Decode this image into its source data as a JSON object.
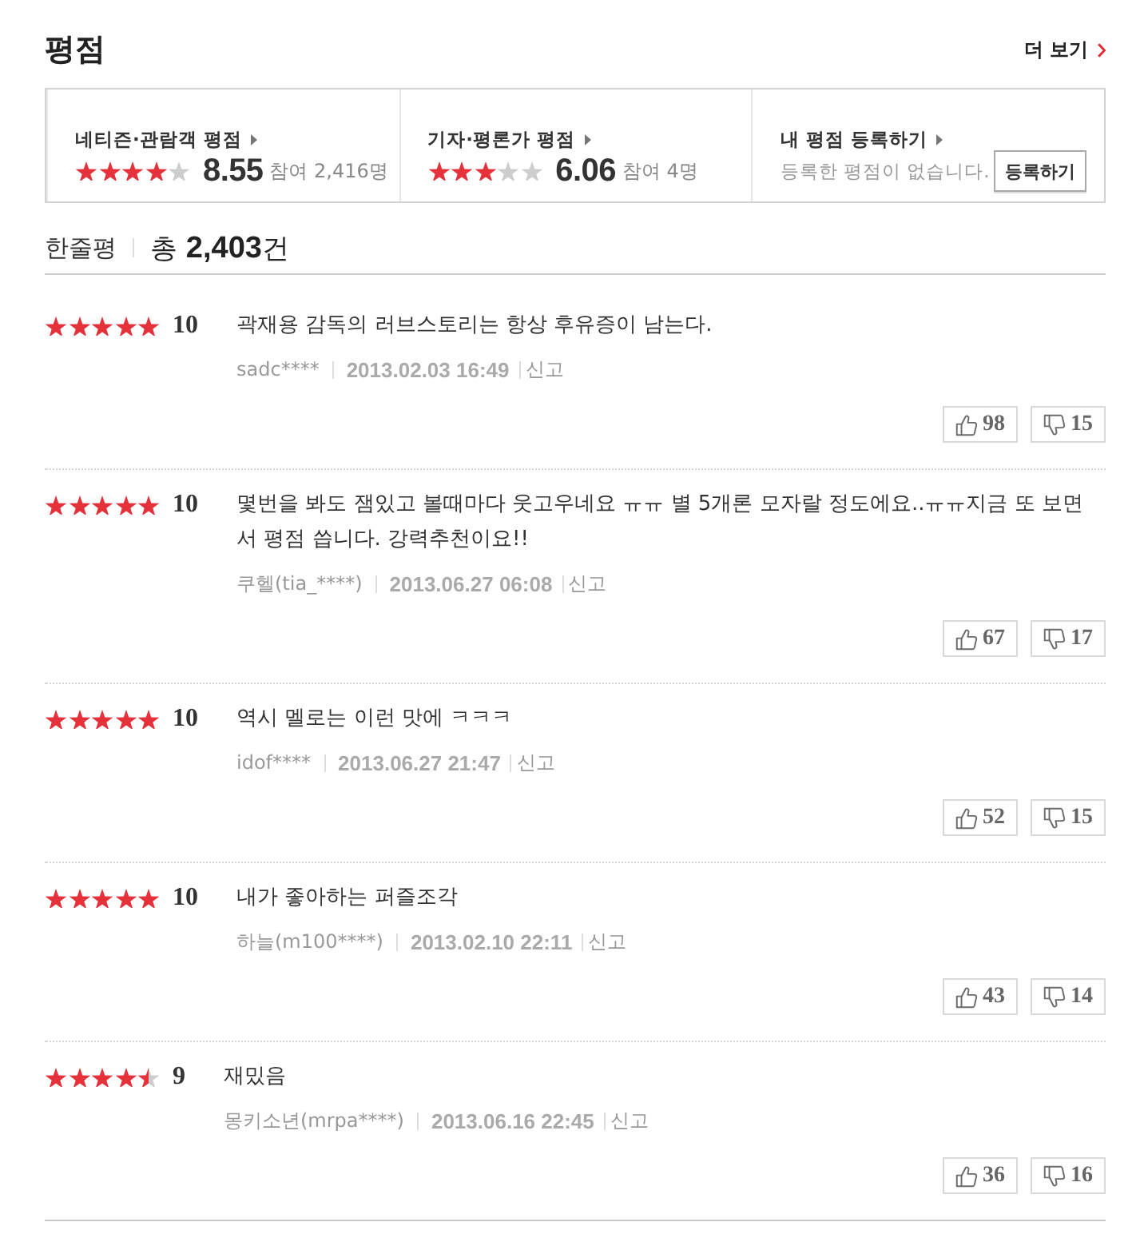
{
  "section": {
    "title": "평점",
    "more_link": "더 보기"
  },
  "summary": [
    {
      "kind": "rating",
      "label": "네티즌·관람객 평점",
      "stars": 4,
      "score": "8.55",
      "participants": "참여 2,416명"
    },
    {
      "kind": "rating",
      "label": "기자·평론가 평점",
      "stars": 3,
      "score": "6.06",
      "participants": "참여 4명"
    },
    {
      "kind": "register",
      "label": "내 평점 등록하기",
      "message": "등록한 평점이 없습니다.",
      "button": "등록하기"
    }
  ],
  "reviews_header": {
    "title": "한줄평",
    "total": "총 **2,403**건"
  },
  "reviews": [
    {
      "stars": 5,
      "score": "10",
      "text": "곽재용 감독의 러브스토리는 항상 후유증이 남는다.",
      "author": "sadc****",
      "date": "2013.02.03 16:49",
      "report": "신고",
      "likes": "98",
      "dislikes": "15"
    },
    {
      "stars": 5,
      "score": "10",
      "text": "몇번을 봐도 잼있고 볼때마다 웃고우네요 ㅠㅠ 별 5개론 모자랄 정도에요..ㅠㅠ지금 또 보면서 평점 씁니다. 강력추천이요!!",
      "author": "쿠헬(tia_****)",
      "date": "2013.06.27 06:08",
      "report": "신고",
      "likes": "67",
      "dislikes": "17"
    },
    {
      "stars": 5,
      "score": "10",
      "text": "역시 멜로는 이런 맛에 ㅋㅋㅋ",
      "author": "idof****",
      "date": "2013.06.27 21:47",
      "report": "신고",
      "likes": "52",
      "dislikes": "15"
    },
    {
      "stars": 5,
      "score": "10",
      "text": "내가 좋아하는 퍼즐조각",
      "author": "하늘(m100****)",
      "date": "2013.02.10 22:11",
      "report": "신고",
      "likes": "43",
      "dislikes": "14"
    },
    {
      "stars": 4.5,
      "score": "9",
      "text": "재밌음",
      "author": "몽키소년(mrpa****)",
      "date": "2013.06.16 22:45",
      "report": "신고",
      "likes": "36",
      "dislikes": "16"
    }
  ]
}
